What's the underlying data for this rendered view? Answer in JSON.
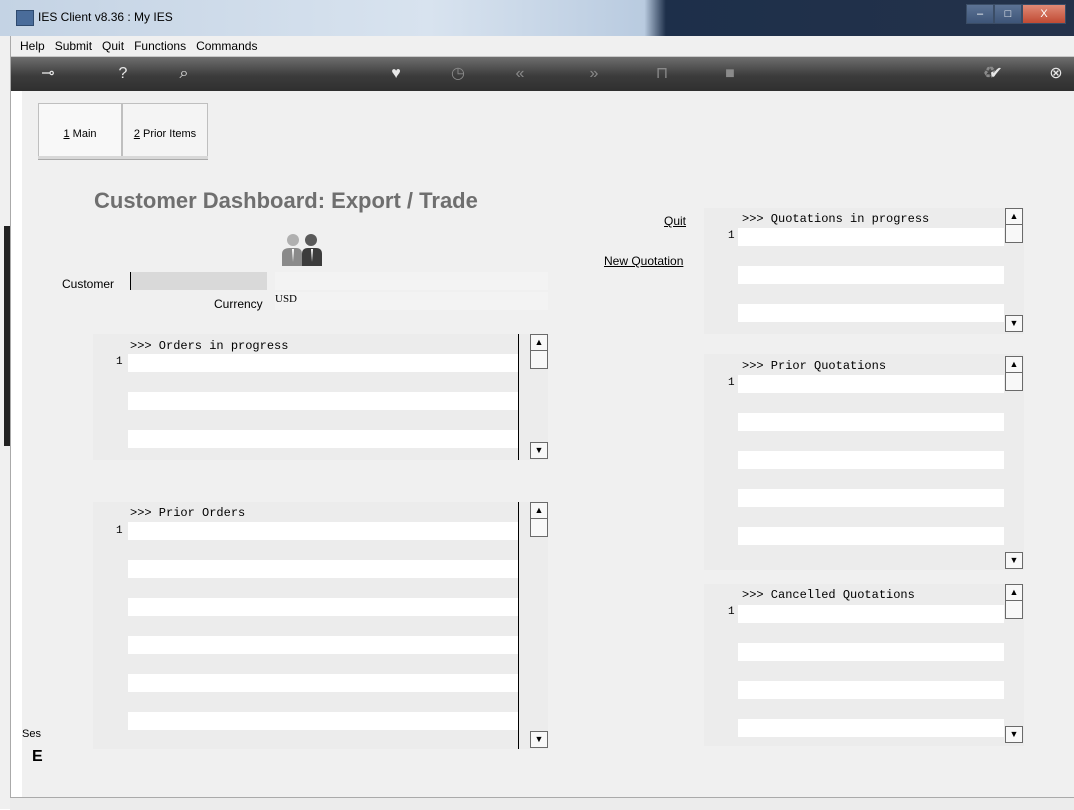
{
  "window": {
    "title": "IES Client v8.36 : My IES",
    "minimize": "–",
    "maximize": "□",
    "close": "X"
  },
  "menu": [
    "Help",
    "Submit",
    "Quit",
    "Functions",
    "Commands"
  ],
  "toolbar_icons": [
    "key-icon",
    "help-icon",
    "search-icon",
    "heart-icon",
    "clock-icon",
    "rewind-icon",
    "fast-forward-icon",
    "tools-icon",
    "stop-icon",
    "recycle-icon",
    "check-icon",
    "close-icon"
  ],
  "tabs": [
    {
      "label_num": "1",
      "label_text": " Main"
    },
    {
      "label_num": "2",
      "label_text": " Prior Items"
    }
  ],
  "page_title": "Customer Dashboard: Export / Trade",
  "customer_label": "Customer",
  "currency_label": "Currency",
  "currency_value": "USD",
  "links": {
    "quit": "Quit",
    "new_quotation": "New Quotation"
  },
  "lists": {
    "orders_in_progress": {
      "header": ">>> Orders in progress",
      "row_number": "1"
    },
    "prior_orders": {
      "header": ">>> Prior Orders",
      "row_number": "1"
    },
    "quotations_in_progress": {
      "header": ">>> Quotations in progress",
      "row_number": "1"
    },
    "prior_quotations": {
      "header": ">>> Prior Quotations",
      "row_number": "1"
    },
    "cancelled_quotations": {
      "header": ">>> Cancelled Quotations",
      "row_number": "1"
    }
  },
  "scroll": {
    "up": "▲",
    "down": "▼"
  },
  "side": {
    "session_label": "Ses",
    "glyph": "E"
  }
}
